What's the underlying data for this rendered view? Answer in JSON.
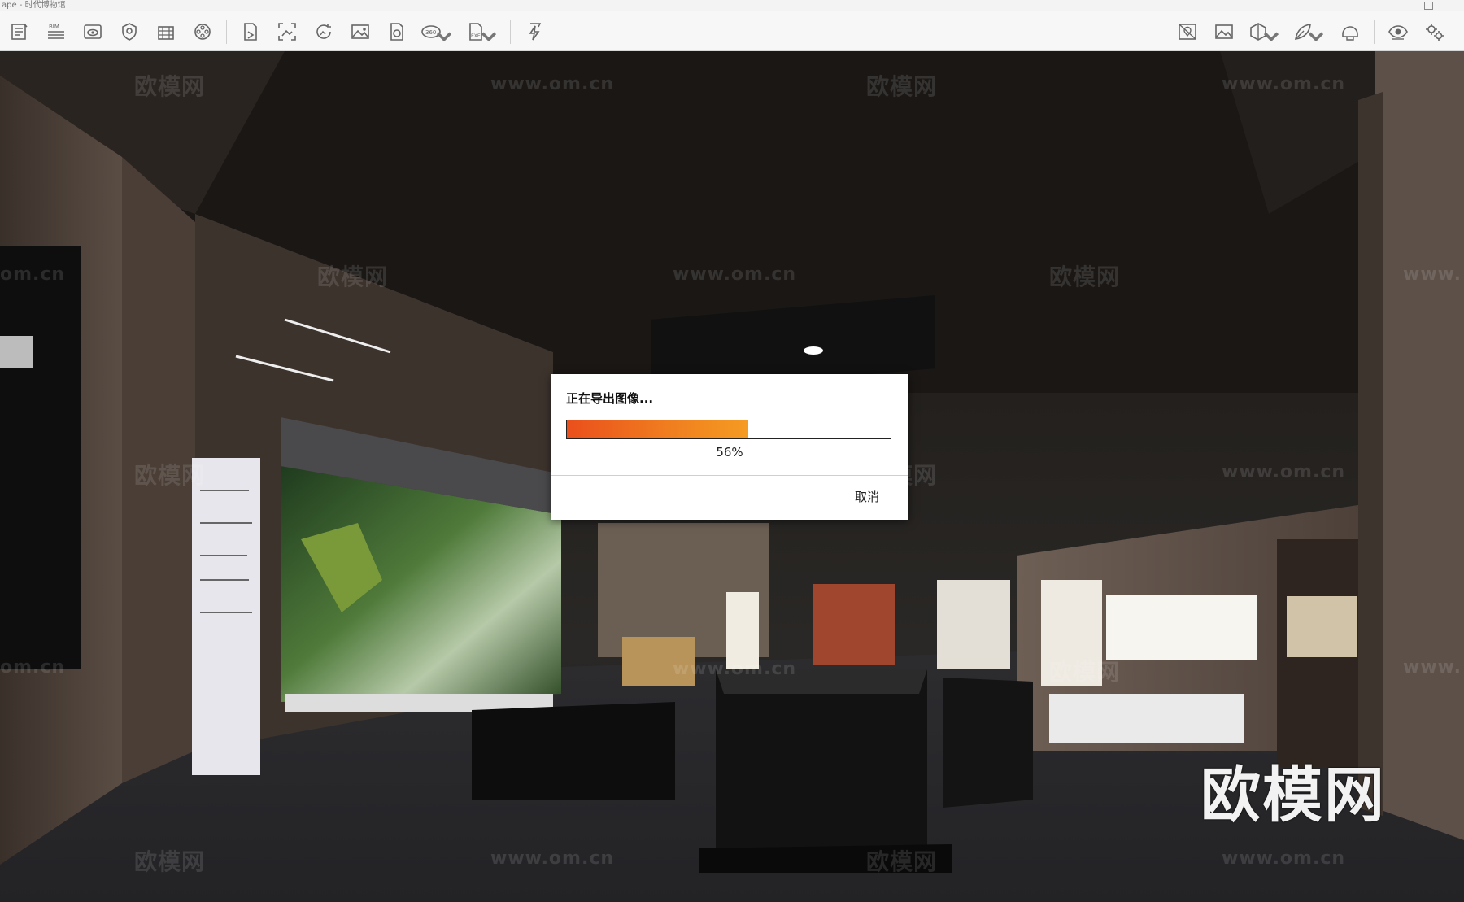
{
  "window": {
    "title": "ape - 时代博物馆"
  },
  "toolbar": {
    "left_tools": [
      {
        "icon": "document-list-icon",
        "tooltip": ""
      },
      {
        "icon": "bim-icon",
        "label": "BIM"
      },
      {
        "icon": "eye-view-icon"
      },
      {
        "icon": "shield-view-icon"
      },
      {
        "icon": "building-icon"
      },
      {
        "icon": "film-reel-icon"
      },
      {
        "icon": "file-export-icon"
      },
      {
        "icon": "image-frame-icon"
      },
      {
        "icon": "rotate-capture-icon"
      },
      {
        "icon": "picture-icon"
      },
      {
        "icon": "file-render-icon"
      },
      {
        "icon": "panorama-360-icon",
        "label": "360",
        "has_dropdown": true
      },
      {
        "icon": "exe-file-icon",
        "label": "EXE",
        "has_dropdown": true
      },
      {
        "icon": "lightning-icon"
      }
    ],
    "right_tools": [
      {
        "icon": "map-icon"
      },
      {
        "icon": "landscape-icon"
      },
      {
        "icon": "cube-icon",
        "has_dropdown": true
      },
      {
        "icon": "leaf-icon",
        "has_dropdown": true
      },
      {
        "icon": "helmet-icon"
      },
      {
        "icon": "visibility-icon"
      },
      {
        "icon": "settings-gears-icon"
      }
    ]
  },
  "scene": {
    "watermarks": [
      "欧模网",
      "www.om.cn",
      "欧模网",
      "www.om.cn",
      "欧模网",
      "www.om.cn",
      "欧模网",
      "www.om.cn",
      "om.cn",
      "www.",
      "欧模网",
      "www.om.cn",
      "欧模网",
      "www.om.cn",
      "欧模网",
      "www.om.cn",
      "欧模网",
      "www.om.cn",
      "om.cn",
      "www."
    ],
    "brand": "欧模网"
  },
  "dialog": {
    "title": "正在导出图像...",
    "progress": 0.56,
    "progress_text": "56%",
    "cancel_label": "取消",
    "fill_colors": [
      "#ea4f1c",
      "#f59b22"
    ]
  }
}
